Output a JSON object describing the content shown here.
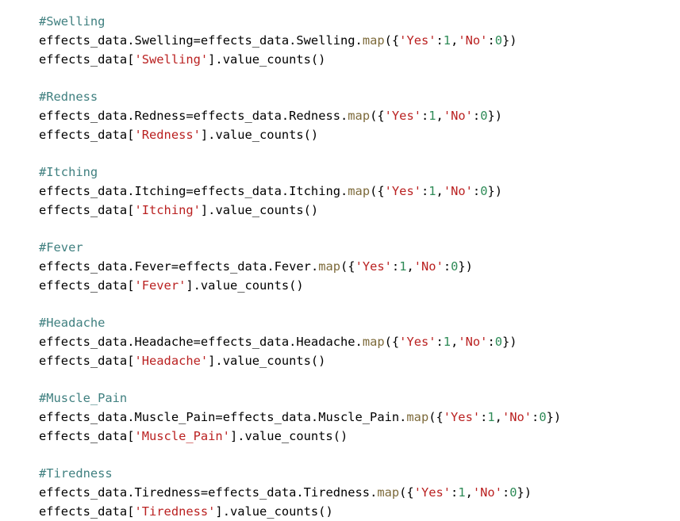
{
  "colors": {
    "background": "#ffffff",
    "text": "#000000",
    "comment": "#408080",
    "method": "#7d6a3a",
    "string": "#ba2121",
    "number": "#2e8b57"
  },
  "code": {
    "var": "effects_data",
    "map_fn": "map",
    "value_counts": "value_counts",
    "yes_str": "'Yes'",
    "no_str": "'No'",
    "one": "1",
    "zero": "0",
    "sections": [
      {
        "comment": "#Swelling",
        "column": "Swelling",
        "quoted": "'Swelling'"
      },
      {
        "comment": "#Redness",
        "column": "Redness",
        "quoted": "'Redness'"
      },
      {
        "comment": "#Itching",
        "column": "Itching",
        "quoted": "'Itching'"
      },
      {
        "comment": "#Fever",
        "column": "Fever",
        "quoted": "'Fever'"
      },
      {
        "comment": "#Headache",
        "column": "Headache",
        "quoted": "'Headache'"
      },
      {
        "comment": "#Muscle_Pain",
        "column": "Muscle_Pain",
        "quoted": "'Muscle_Pain'"
      },
      {
        "comment": "#Tiredness",
        "column": "Tiredness",
        "quoted": "'Tiredness'"
      }
    ]
  }
}
